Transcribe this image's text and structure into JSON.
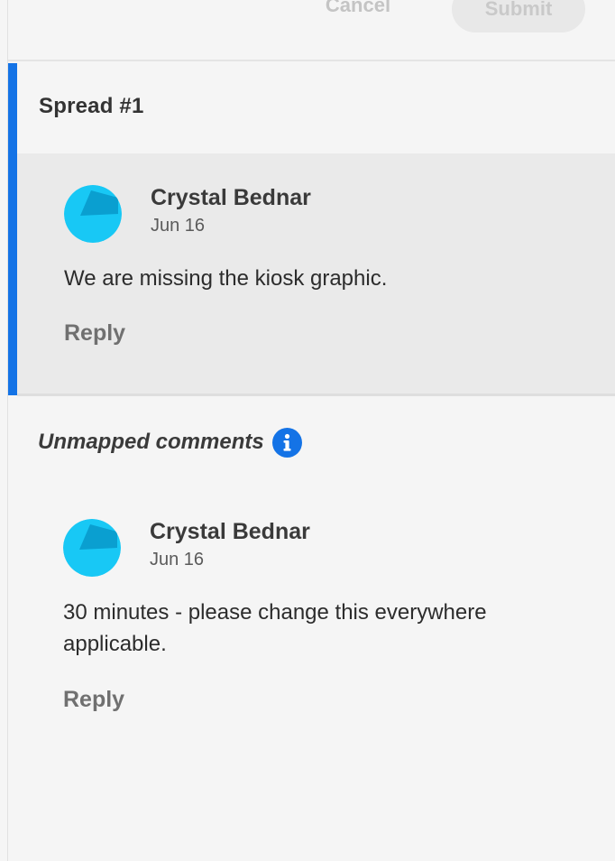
{
  "actions": {
    "cancel_label": "Cancel",
    "submit_label": "Submit"
  },
  "spread": {
    "title": "Spread #1",
    "comments": [
      {
        "author": "Crystal Bednar",
        "date": "Jun 16",
        "text": "We are missing the kiosk graphic.",
        "reply_label": "Reply"
      }
    ]
  },
  "unmapped": {
    "title": "Unmapped comments",
    "info_icon": "info-icon",
    "comments": [
      {
        "author": "Crystal Bednar",
        "date": "Jun 16",
        "text": "30 minutes - please change this everywhere applicable.",
        "reply_label": "Reply"
      }
    ]
  },
  "colors": {
    "accent": "#1473e6",
    "avatar_light": "#18c8f5",
    "avatar_dark": "#0a9fd0",
    "selected_bg": "#eaeaea",
    "panel_bg": "#f5f5f5"
  }
}
